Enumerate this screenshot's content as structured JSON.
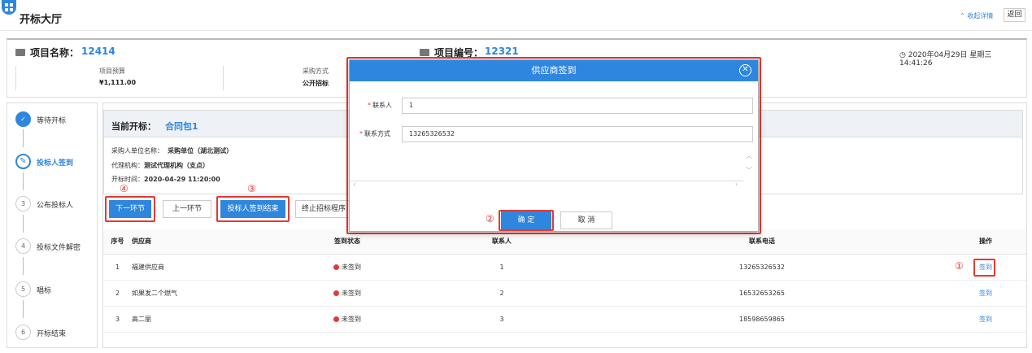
{
  "header": {
    "title": "开标大厅",
    "collapse": "⌃ 收起详情",
    "back": "返回"
  },
  "project": {
    "name_label": "项目名称：",
    "name": "12414",
    "code_label": "项目编号：",
    "code": "12321",
    "datetime": "2020年04月29日 星期三 14:41:26",
    "budget_label": "项目预算",
    "budget": "¥1,111.00",
    "method_label": "采购方式",
    "method": "公开招标"
  },
  "steps": [
    {
      "num": "✓",
      "label": "等待开标"
    },
    {
      "num": "✎",
      "label": "投标人签到"
    },
    {
      "num": "3",
      "label": "公布投标人"
    },
    {
      "num": "4",
      "label": "投标文件解密"
    },
    {
      "num": "5",
      "label": "唱标"
    },
    {
      "num": "6",
      "label": "开标结束"
    }
  ],
  "package": {
    "title": "当前开标：",
    "name": "合同包1",
    "buyer_label": "采购人单位名称：",
    "buyer": "采购单位（湖北测试）",
    "agent_label": "代理机构：",
    "agent": "测试代理机构（支点）",
    "time_label": "开标时间：",
    "time": "2020-04-29 11:20:00"
  },
  "actions": {
    "next": "下一环节",
    "prev": "上一环节",
    "finish_signin": "投标人签到结束",
    "terminate": "终止招标程序"
  },
  "markers": {
    "m1": "①",
    "m2": "②",
    "m3": "③",
    "m4": "④"
  },
  "table": {
    "headers": [
      "序号",
      "供应商",
      "签到状态",
      "联系人",
      "联系电话",
      "操作"
    ],
    "rows": [
      {
        "no": "1",
        "supplier": "福建供应商",
        "status": "未签到",
        "contact": "1",
        "phone": "13265326532",
        "op": "签到"
      },
      {
        "no": "2",
        "supplier": "如果发二个燃气",
        "status": "未签到",
        "contact": "2",
        "phone": "16532653265",
        "op": "签到"
      },
      {
        "no": "3",
        "supplier": "高二丽",
        "status": "未签到",
        "contact": "3",
        "phone": "18598659865",
        "op": "签到"
      }
    ]
  },
  "modal": {
    "title": "供应商签到",
    "contact_label": "联系人",
    "contact_value": "1",
    "phone_label": "联系方式",
    "phone_value": "13265326532",
    "ok": "确 定",
    "cancel": "取 消"
  },
  "colors": {
    "accent": "#2e86de",
    "danger": "#e53935"
  }
}
